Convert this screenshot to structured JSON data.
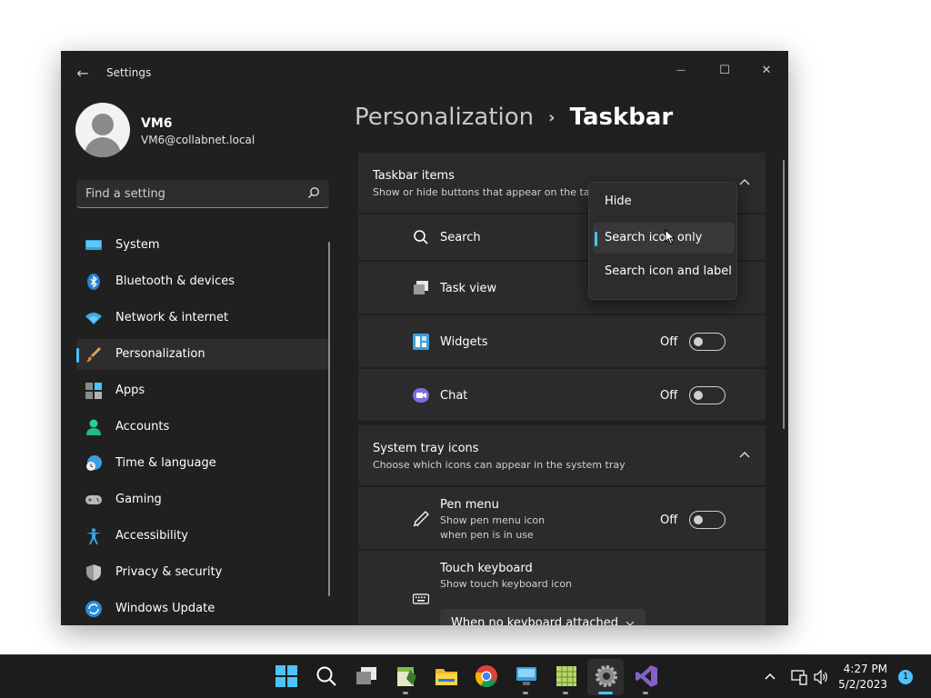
{
  "window": {
    "app_title": "Settings",
    "back_glyph": "←",
    "minimize_glyph": "—",
    "maximize_glyph": "☐",
    "close_glyph": "✕"
  },
  "profile": {
    "name": "VM6",
    "email": "VM6@collabnet.local"
  },
  "search": {
    "placeholder": "Find a setting"
  },
  "sidebar": {
    "items": [
      {
        "label": "System",
        "icon": "monitor-icon"
      },
      {
        "label": "Bluetooth & devices",
        "icon": "bluetooth-icon"
      },
      {
        "label": "Network & internet",
        "icon": "wifi-icon"
      },
      {
        "label": "Personalization",
        "icon": "paintbrush-icon",
        "active": true
      },
      {
        "label": "Apps",
        "icon": "apps-icon"
      },
      {
        "label": "Accounts",
        "icon": "person-icon"
      },
      {
        "label": "Time & language",
        "icon": "globe-clock-icon"
      },
      {
        "label": "Gaming",
        "icon": "gamepad-icon"
      },
      {
        "label": "Accessibility",
        "icon": "accessibility-icon"
      },
      {
        "label": "Privacy & security",
        "icon": "shield-icon"
      },
      {
        "label": "Windows Update",
        "icon": "update-icon"
      }
    ]
  },
  "header": {
    "parent": "Personalization",
    "separator": "›",
    "current": "Taskbar"
  },
  "taskbar_items": {
    "title": "Taskbar items",
    "description": "Show or hide buttons that appear on the tas",
    "rows": [
      {
        "label": "Search"
      },
      {
        "label": "Task view"
      },
      {
        "label": "Widgets",
        "state": "Off"
      },
      {
        "label": "Chat",
        "state": "Off"
      }
    ]
  },
  "search_menu": {
    "options": [
      "Hide",
      "Search icon only",
      "Search icon and label"
    ],
    "selected_index": 1
  },
  "system_tray": {
    "title": "System tray icons",
    "description": "Choose which icons can appear in the system tray",
    "pen_menu": {
      "label": "Pen menu",
      "sub_line1": "Show pen menu icon",
      "sub_line2": "when pen is in use",
      "state": "Off"
    },
    "touch_keyboard": {
      "label": "Touch keyboard",
      "sub": "Show touch keyboard icon",
      "dropdown_value": "When no keyboard attached"
    }
  },
  "os_taskbar": {
    "time": "4:27 PM",
    "date": "5/2/2023",
    "notification_count": "1",
    "accent": "#4cc2ff"
  }
}
